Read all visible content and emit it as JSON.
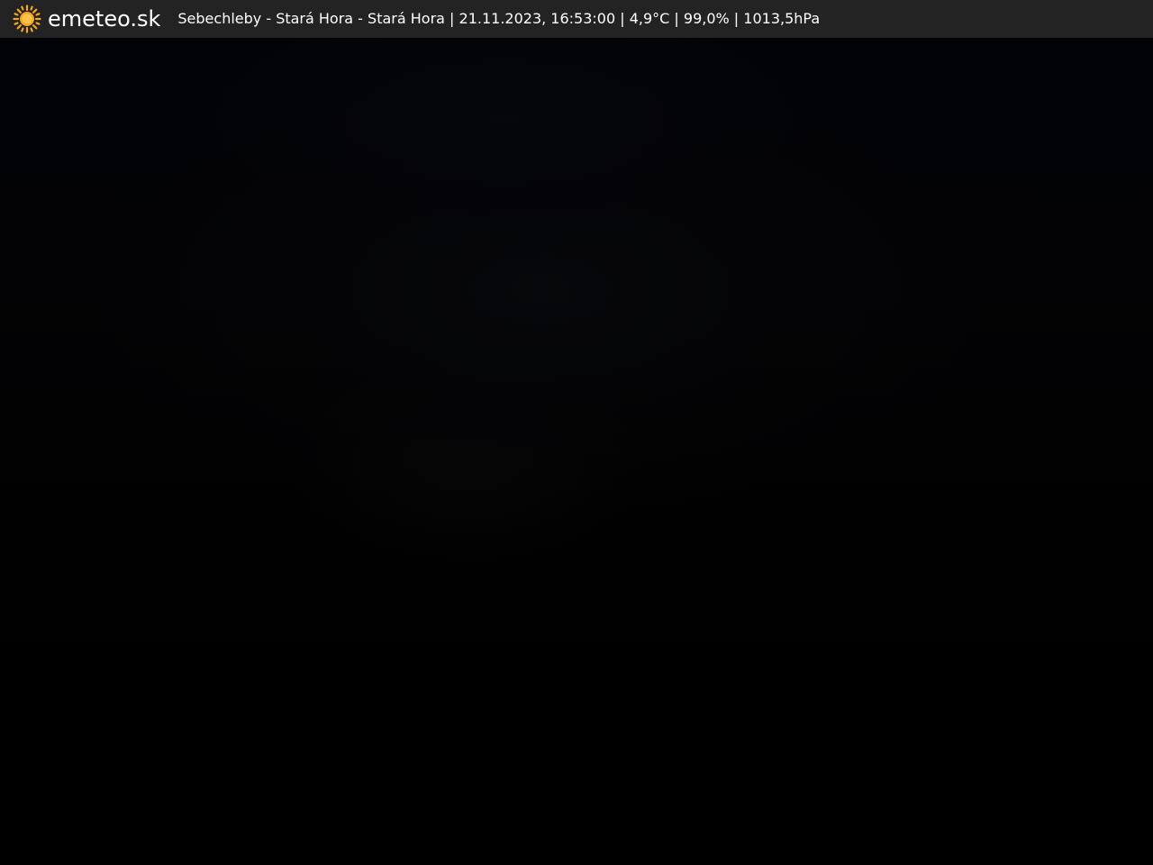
{
  "header": {
    "logo_icon": "sun-icon",
    "logo_icon_color": "#f5a623",
    "brand": "emeteo.sk",
    "caption": "Sebechleby - Stará Hora - Stará Hora | 21.11.2023, 16:53:00 | 4,9°C | 99,0% | 1013,5hPa",
    "background": "#232323"
  },
  "webcam": {
    "background": "#000000"
  }
}
